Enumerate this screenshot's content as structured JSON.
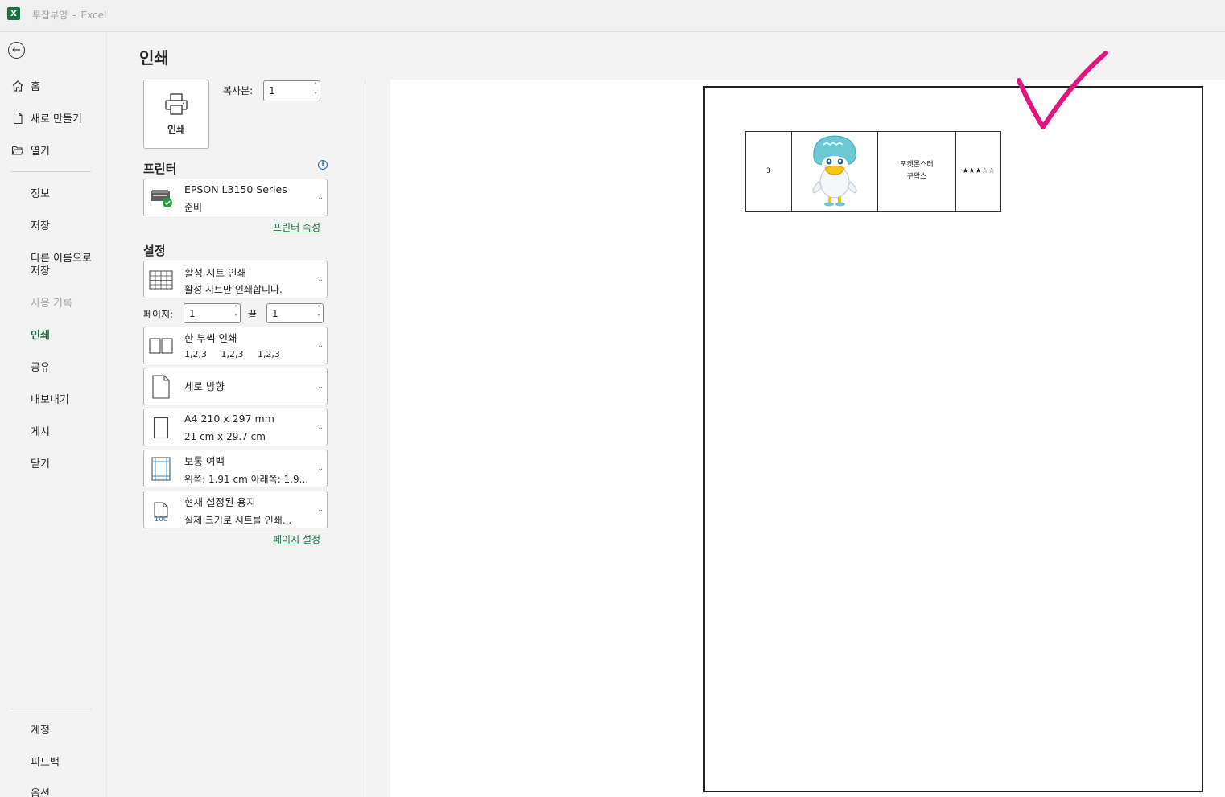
{
  "titlebar": {
    "doc_name": "투잡부엉",
    "separator": "-",
    "app_name": "Excel",
    "logo_letter": "X"
  },
  "nav": {
    "back_icon": "←",
    "items": [
      {
        "label": "홈",
        "icon": "home-icon"
      },
      {
        "label": "새로 만들기",
        "icon": "new-file-icon"
      },
      {
        "label": "열기",
        "icon": "open-folder-icon"
      }
    ],
    "info": "정보",
    "save": "저장",
    "save_as_line1": "다른 이름으로",
    "save_as_line2": "저장",
    "history": "사용 기록",
    "print": "인쇄",
    "share": "공유",
    "export": "내보내기",
    "publish": "게시",
    "close": "닫기",
    "account": "계정",
    "feedback": "피드백",
    "options": "옵션"
  },
  "panel": {
    "title": "인쇄",
    "print_button_label": "인쇄",
    "copies_label": "복사본:",
    "copies_value": "1",
    "printer_heading": "프린터",
    "printer_name": "EPSON L3150 Series",
    "printer_status": "준비",
    "printer_properties_link": "프린터 속성",
    "settings_heading": "설정",
    "scope_title": "활성 시트 인쇄",
    "scope_desc": "활성 시트만 인쇄합니다.",
    "pages_label": "페이지:",
    "pages_from": "1",
    "pages_to_label": "끝",
    "pages_to": "1",
    "collate_title": "한 부씩 인쇄",
    "collate_desc": "1,2,3     1,2,3     1,2,3",
    "orientation_title": "세로 방향",
    "paper_title": "A4 210 x 297 mm",
    "paper_desc": "21 cm x 29.7 cm",
    "margins_title": "보통 여백",
    "margins_desc": "위쪽: 1.91 cm 아래쪽: 1.9...",
    "scaling_title": "현재 설정된 용지",
    "scaling_desc": "실제 크기로 시트를 인쇄...",
    "scaling_icon_text": "100",
    "page_setup_link": "페이지 설정"
  },
  "preview": {
    "row_number": "3",
    "name_line1": "포켓몬스터",
    "name_line2": "꾸왁스",
    "rating": "★★★☆☆",
    "annotation_color": "#e0157f"
  },
  "colors": {
    "accent": "#1d6f42",
    "check_mark": "#e0157f"
  }
}
